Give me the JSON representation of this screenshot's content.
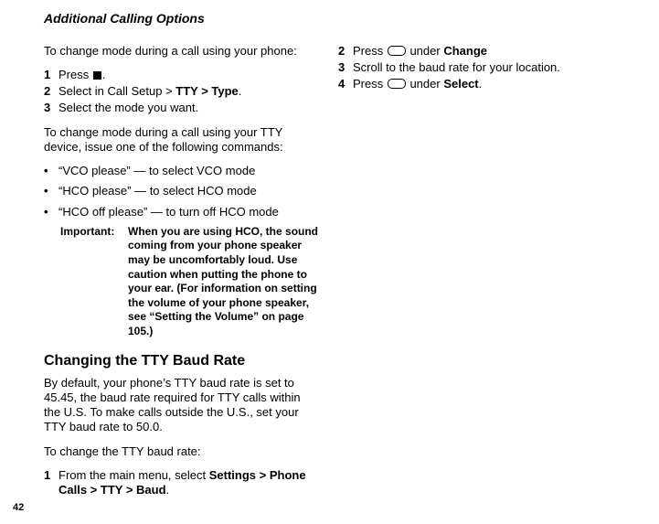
{
  "header": "Additional Calling Options",
  "pageNumber": "42",
  "left": {
    "intro1": "To change mode during a call using your phone:",
    "steps1": [
      {
        "num": "1",
        "pre": "Press ",
        "icon": "square",
        "post": "."
      },
      {
        "num": "2",
        "pre": "Select in Call Setup > ",
        "bold": "TTY > Type",
        "post": "."
      },
      {
        "num": "3",
        "pre": "Select the mode you want."
      }
    ],
    "intro2": "To change mode during a call using your TTY device, issue one of the following commands:",
    "bullets": [
      "“VCO please” — to select VCO mode",
      "“HCO please” — to select HCO mode",
      "“HCO off please” — to turn off HCO mode"
    ],
    "importantLabel": "Important:",
    "importantBody": "When you are using HCO, the sound coming from your phone speaker may be uncomfortably loud. Use caution when putting the phone to your ear. (For information on setting the volume of your phone speaker, see “Setting the Volume” on page 105.)",
    "h2": "Changing the TTY Baud Rate",
    "p1": "By default, your phone’s TTY baud rate is set to 45.45, the baud rate required for TTY calls within the U.S. To make calls outside the U.S., set your TTY baud rate to 50.0.",
    "p2": "To change the TTY baud rate:",
    "steps2": [
      {
        "num": "1",
        "pre": "From the main menu, select ",
        "bold": "Settings > Phone Calls > TTY > Baud",
        "post": "."
      }
    ]
  },
  "right": {
    "steps": [
      {
        "num": "2",
        "pre": "Press ",
        "icon": "oblong",
        "mid": " under ",
        "bold": "Change"
      },
      {
        "num": "3",
        "pre": "Scroll to the baud rate for your location."
      },
      {
        "num": "4",
        "pre": "Press ",
        "icon": "oblong",
        "mid": " under ",
        "bold": "Select",
        "post": "."
      }
    ]
  }
}
